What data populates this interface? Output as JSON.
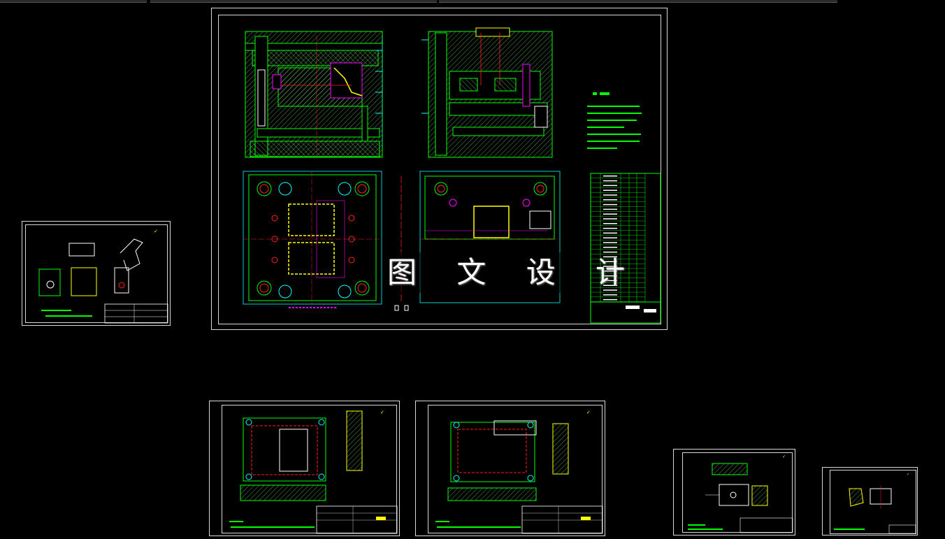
{
  "watermark_text": "图 文 设 计",
  "colors": {
    "background": "#000000",
    "frame": "#d8d8d8",
    "outline": "#00ff00",
    "hatch": "#7fff7f",
    "magenta": "#ff00ff",
    "red": "#ff2020",
    "yellow": "#ffff00",
    "cyan": "#00ffff",
    "white": "#ffffff"
  },
  "icons": [
    "roughness-symbol-icon"
  ],
  "sheets": [
    {
      "id": "main-assembly-sheet"
    },
    {
      "id": "part-bracket-sheet"
    },
    {
      "id": "core-plate-sheet"
    },
    {
      "id": "cavity-plate-sheet"
    },
    {
      "id": "slider-part-sheet"
    },
    {
      "id": "insert-part-sheet"
    }
  ]
}
